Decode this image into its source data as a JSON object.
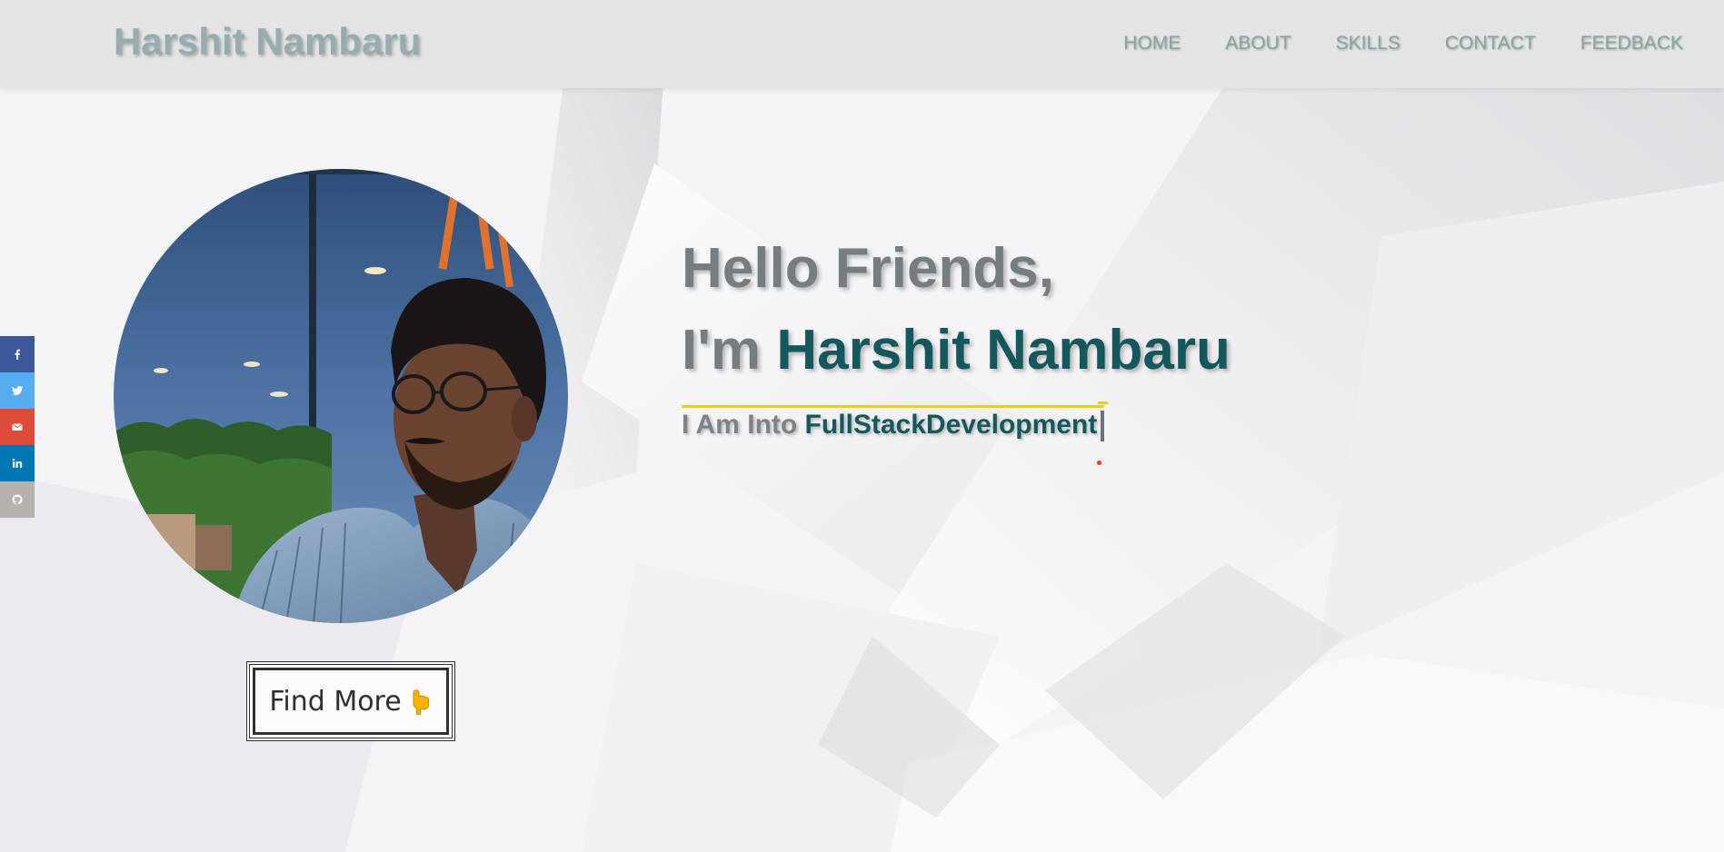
{
  "navbar": {
    "brand": "Harshit Nambaru",
    "links": [
      "HOME",
      "ABOUT",
      "SKILLS",
      "CONTACT",
      "FEEDBACK"
    ]
  },
  "social": {
    "items": [
      {
        "icon": "facebook-icon",
        "color": "#3b5998"
      },
      {
        "icon": "twitter-icon",
        "color": "#55acee"
      },
      {
        "icon": "email-icon",
        "color": "#dd4b39"
      },
      {
        "icon": "linkedin-icon",
        "color": "#0077b5"
      },
      {
        "icon": "github-icon",
        "color": "#b5b1af"
      }
    ]
  },
  "hero": {
    "greeting": "Hello Friends,",
    "intro_prefix": "I'm ",
    "name": "Harshit Nambaru",
    "into_prefix": "I Am Into ",
    "role": "FullStackDevelopment"
  },
  "cta": {
    "label": "Find More",
    "emoji_icon": "pointing-down-hand-icon"
  },
  "colors": {
    "accent": "#14585e",
    "muted": "#757d80",
    "nav_bg": "#e3e4e3",
    "underline": "#e8cf1c"
  }
}
